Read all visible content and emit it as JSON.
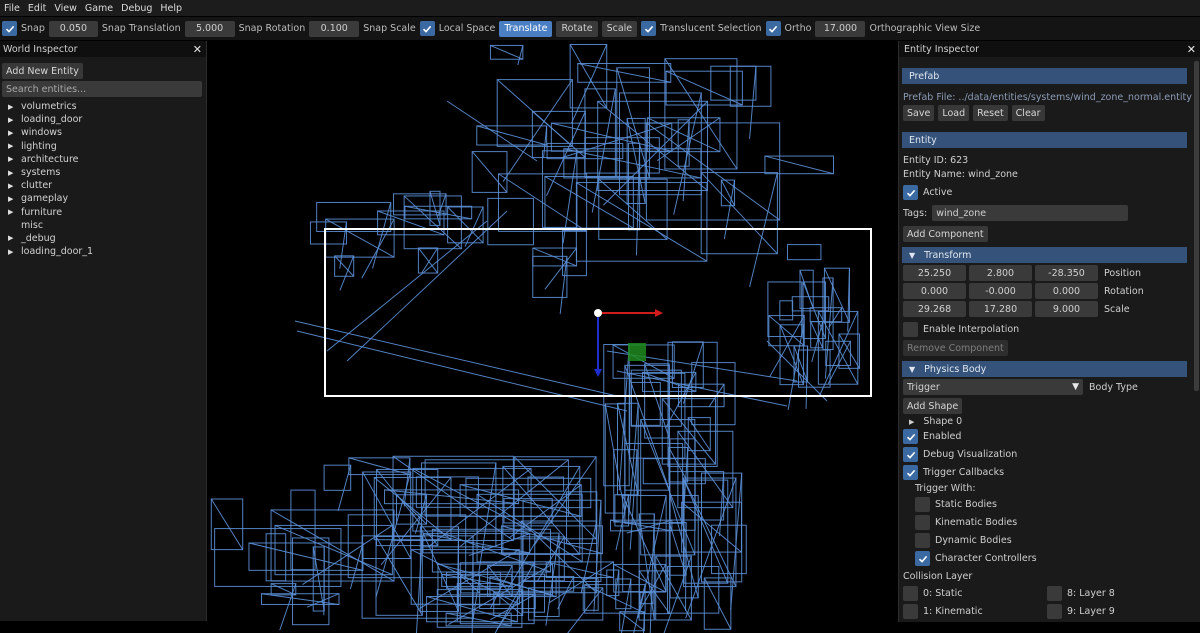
{
  "menu": [
    "File",
    "Edit",
    "View",
    "Game",
    "Debug",
    "Help"
  ],
  "toolbar": {
    "snap_label": "Snap",
    "snap_value": "0.050",
    "snap_translation_label": "Snap Translation",
    "snap_translation_value": "5.000",
    "snap_rotation_label": "Snap Rotation",
    "snap_rotation_value": "0.100",
    "snap_scale_label": "Snap Scale",
    "local_space_label": "Local Space",
    "translate_label": "Translate",
    "rotate_label": "Rotate",
    "scale_label": "Scale",
    "translucent_label": "Translucent Selection",
    "ortho_label": "Ortho",
    "ortho_value": "17.000",
    "ortho_view_label": "Orthographic View Size"
  },
  "world_inspector": {
    "title": "World Inspector",
    "add_entity": "Add New Entity",
    "search_placeholder": "Search entities...",
    "items": [
      {
        "label": "volumetrics",
        "expandable": true
      },
      {
        "label": "loading_door",
        "expandable": true
      },
      {
        "label": "windows",
        "expandable": true
      },
      {
        "label": "lighting",
        "expandable": true
      },
      {
        "label": "architecture",
        "expandable": true
      },
      {
        "label": "systems",
        "expandable": true
      },
      {
        "label": "clutter",
        "expandable": true
      },
      {
        "label": "gameplay",
        "expandable": true
      },
      {
        "label": "furniture",
        "expandable": true
      },
      {
        "label": "misc",
        "expandable": false
      },
      {
        "label": "_debug",
        "expandable": true
      },
      {
        "label": "loading_door_1",
        "expandable": true
      }
    ]
  },
  "entity_inspector": {
    "title": "Entity Inspector",
    "prefab_header": "Prefab",
    "prefab_file": "Prefab File: ../data/entities/systems/wind_zone_normal.entity",
    "prefab_buttons": [
      "Save",
      "Load",
      "Reset",
      "Clear"
    ],
    "entity_header": "Entity",
    "entity_id": "Entity ID: 623",
    "entity_name": "Entity Name: wind_zone",
    "active_label": "Active",
    "tags_label": "Tags:",
    "tags_value": "wind_zone",
    "add_component": "Add Component",
    "transform_header": "Transform",
    "position": [
      "25.250",
      "2.800",
      "-28.350"
    ],
    "position_label": "Position",
    "rotation": [
      "0.000",
      "-0.000",
      "0.000"
    ],
    "rotation_label": "Rotation",
    "scale": [
      "29.268",
      "17.280",
      "9.000"
    ],
    "scale_label": "Scale",
    "enable_interpolation": "Enable Interpolation",
    "remove_component": "Remove Component",
    "physics_header": "Physics Body",
    "body_type_value": "Trigger",
    "body_type_label": "Body Type",
    "add_shape": "Add Shape",
    "shape0": "Shape 0",
    "enabled_label": "Enabled",
    "debug_vis_label": "Debug Visualization",
    "trigger_callbacks_label": "Trigger Callbacks",
    "trigger_with_label": "Trigger With:",
    "trigger_with": [
      {
        "label": "Static Bodies",
        "checked": false
      },
      {
        "label": "Kinematic Bodies",
        "checked": false
      },
      {
        "label": "Dynamic Bodies",
        "checked": false
      },
      {
        "label": "Character Controllers",
        "checked": true
      }
    ],
    "collision_layer_label": "Collision Layer",
    "layers_left": [
      "0: Static",
      "1: Kinematic"
    ],
    "layers_right": [
      "8: Layer 8",
      "9: Layer 9"
    ]
  },
  "colors": {
    "accent": "#4a7fc4",
    "section": "#35537a",
    "wireframe": "#5b8fd6",
    "selection_box": "#ffffff",
    "gizmo_x": "#d01c1c",
    "gizmo_y": "#1c2ed0",
    "gizmo_z": "#1f8a1f"
  }
}
